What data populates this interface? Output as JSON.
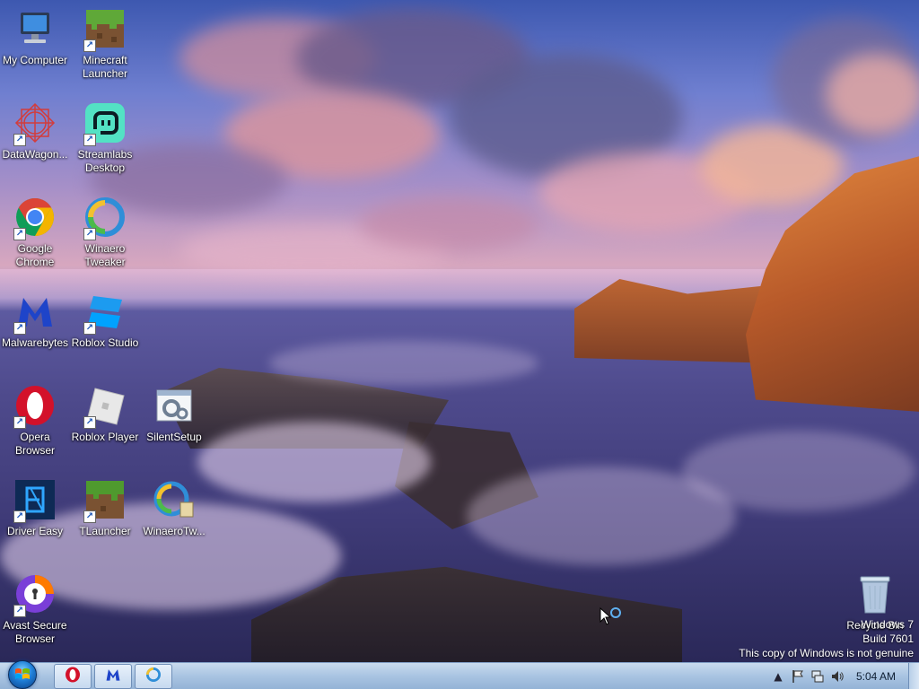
{
  "desktop": {
    "icons": [
      {
        "label": "My Computer",
        "icon": "computer-icon"
      },
      {
        "label": "Minecraft Launcher",
        "icon": "minecraft-icon"
      },
      {
        "label": "DataWagon...",
        "icon": "datawagon-icon"
      },
      {
        "label": "Streamlabs Desktop",
        "icon": "streamlabs-icon"
      },
      {
        "label": "Google Chrome",
        "icon": "chrome-icon"
      },
      {
        "label": "Winaero Tweaker",
        "icon": "winaero-icon"
      },
      {
        "label": "Malwarebytes",
        "icon": "malwarebytes-icon"
      },
      {
        "label": "Roblox Studio",
        "icon": "roblox-studio-icon"
      },
      {
        "label": "Opera Browser",
        "icon": "opera-icon"
      },
      {
        "label": "Roblox Player",
        "icon": "roblox-player-icon"
      },
      {
        "label": "SilentSetup",
        "icon": "silentsetup-icon"
      },
      {
        "label": "Driver Easy",
        "icon": "drivereasy-icon"
      },
      {
        "label": "TLauncher",
        "icon": "tlauncher-icon"
      },
      {
        "label": "WinaeroTw...",
        "icon": "winaero-installer-icon"
      },
      {
        "label": "Avast Secure Browser",
        "icon": "avast-icon"
      },
      {
        "label": "Recycle Bin",
        "icon": "recycle-bin-icon"
      }
    ]
  },
  "watermark": {
    "line1": "Windows 7",
    "line2": "Build 7601",
    "line3": "This copy of Windows is not genuine"
  },
  "taskbar": {
    "pinned": [
      "opera-icon",
      "malwarebytes-icon",
      "winaero-icon"
    ],
    "clock": "5:04 AM"
  },
  "colors": {
    "taskbar": "#a9c4e2",
    "opera_red": "#d3112a",
    "malwarebytes_blue": "#1e44c9",
    "chrome_red": "#db4437",
    "chrome_yellow": "#f4b400",
    "chrome_green": "#0f9d58",
    "chrome_blue": "#4285f4"
  }
}
